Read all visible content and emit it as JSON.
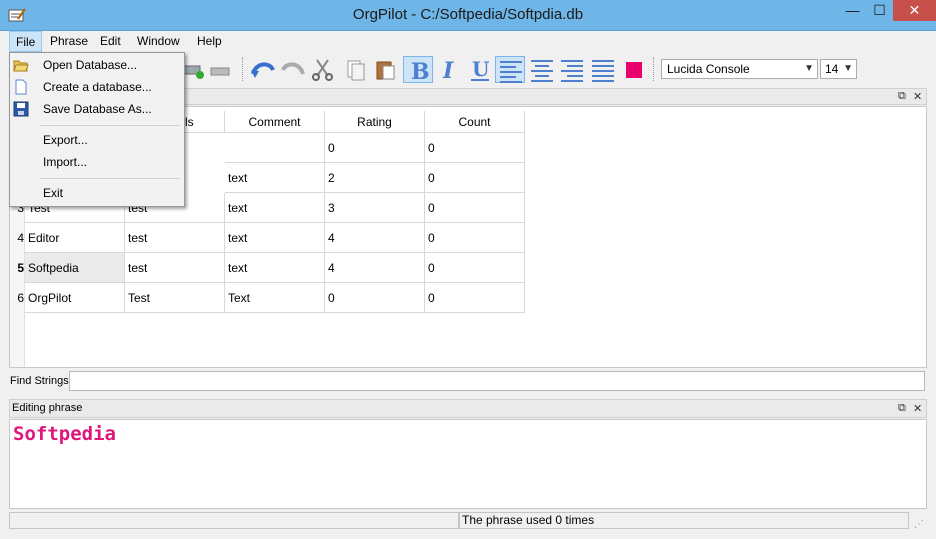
{
  "window": {
    "title": "OrgPilot - C:/Softpedia/Softpdia.db",
    "minimize": "—",
    "maximize": "☐",
    "close": "✕"
  },
  "menubar": {
    "items": [
      "File",
      "Phrase",
      "Edit",
      "Window",
      "Help"
    ]
  },
  "file_menu": {
    "items": [
      "Open Database...",
      "Create a database...",
      "Save Database As...",
      "Export...",
      "Import...",
      "Exit"
    ]
  },
  "toolbar": {
    "font": "Lucida Console",
    "size": "14",
    "color_swatch": "#e8006e",
    "icons": [
      "folder-open-icon",
      "new-file-icon",
      "save-icon",
      "add-row-icon",
      "remove-row-icon",
      "undo-icon",
      "redo-icon",
      "cut-icon",
      "copy-icon",
      "paste-icon",
      "bold-icon",
      "italic-icon",
      "underline-icon",
      "align-left-icon",
      "align-center-icon",
      "align-right-icon",
      "justify-icon",
      "text-color-icon"
    ]
  },
  "table": {
    "columns": [
      "",
      "",
      "ls",
      "Comment",
      "Rating",
      "Count"
    ],
    "rows": [
      {
        "num": "",
        "phrase": "",
        "tags": "",
        "comment": "",
        "rating": "0",
        "count": "0"
      },
      {
        "num": "",
        "phrase": "",
        "tags": "",
        "comment": "text",
        "rating": "2",
        "count": "0"
      },
      {
        "num": "3",
        "phrase": "Test",
        "tags": "test",
        "comment": "text",
        "rating": "3",
        "count": "0"
      },
      {
        "num": "4",
        "phrase": "Editor",
        "tags": "test",
        "comment": "text",
        "rating": "4",
        "count": "0"
      },
      {
        "num": "5",
        "phrase": "Softpedia",
        "tags": "test",
        "comment": "text",
        "rating": "4",
        "count": "0"
      },
      {
        "num": "6",
        "phrase": "OrgPilot",
        "tags": "Test",
        "comment": "Text",
        "rating": "0",
        "count": "0"
      }
    ]
  },
  "find": {
    "label": "Find Strings",
    "value": ""
  },
  "editing": {
    "title": "Editing phrase",
    "content": "Softpedia"
  },
  "status": {
    "message": "The phrase used 0 times"
  }
}
